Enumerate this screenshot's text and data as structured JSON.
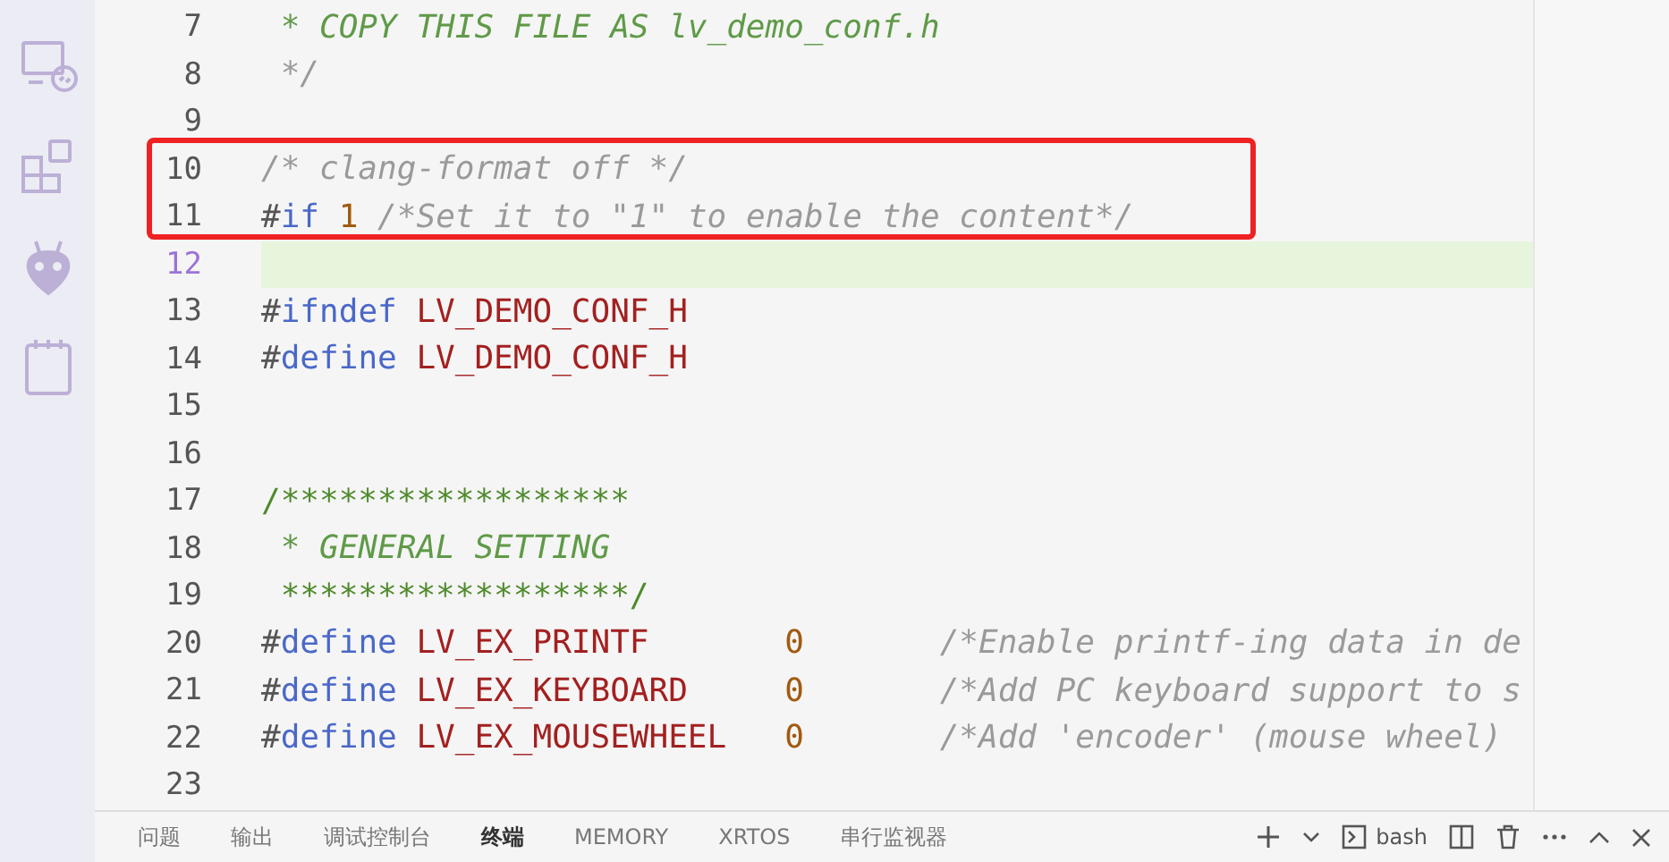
{
  "activity_bar": {
    "items": [
      {
        "kind": "remote",
        "selected": false
      },
      {
        "kind": "extensions",
        "selected": false
      },
      {
        "kind": "platformio",
        "selected": false
      },
      {
        "kind": "notes",
        "selected": false
      }
    ]
  },
  "editor": {
    "lines": [
      {
        "number": "7",
        "current": false,
        "highlighted": false,
        "tokens": [
          {
            "kind": "doc",
            "text": " * COPY THIS FILE AS lv_demo_conf.h"
          }
        ]
      },
      {
        "number": "8",
        "current": false,
        "highlighted": false,
        "tokens": [
          {
            "kind": "muted",
            "text": " */"
          }
        ]
      },
      {
        "number": "9",
        "current": false,
        "highlighted": false
      },
      {
        "number": "10",
        "current": false,
        "highlighted": false,
        "tokens": [
          {
            "kind": "muted",
            "text": "/* clang-format off */"
          }
        ]
      },
      {
        "number": "11",
        "current": false,
        "highlighted": false,
        "tokens": [
          {
            "kind": "plain",
            "text": "#"
          },
          {
            "kind": "keyword",
            "text": "if"
          },
          {
            "kind": "number",
            "text": " 1"
          },
          {
            "kind": "muted",
            "text": " /*Set it to \"1\" to enable the content*/"
          }
        ]
      },
      {
        "number": "12",
        "current": true,
        "highlighted": true
      },
      {
        "number": "13",
        "current": false,
        "highlighted": false,
        "tokens": [
          {
            "kind": "plain",
            "text": "#"
          },
          {
            "kind": "keyword",
            "text": "ifndef"
          },
          {
            "kind": "macro",
            "text": " LV_DEMO_CONF_H"
          }
        ]
      },
      {
        "number": "14",
        "current": false,
        "highlighted": false,
        "tokens": [
          {
            "kind": "plain",
            "text": "#"
          },
          {
            "kind": "keyword",
            "text": "define"
          },
          {
            "kind": "macro",
            "text": " LV_DEMO_CONF_H"
          }
        ]
      },
      {
        "number": "15",
        "current": false,
        "highlighted": false
      },
      {
        "number": "16",
        "current": false,
        "highlighted": false
      },
      {
        "number": "17",
        "current": false,
        "highlighted": false,
        "tokens": [
          {
            "kind": "banner",
            "text": "/******************"
          }
        ]
      },
      {
        "number": "18",
        "current": false,
        "highlighted": false,
        "tokens": [
          {
            "kind": "doc",
            "text": " * GENERAL SETTING"
          }
        ]
      },
      {
        "number": "19",
        "current": false,
        "highlighted": false,
        "tokens": [
          {
            "kind": "banner",
            "text": " ******************/"
          }
        ]
      },
      {
        "number": "20",
        "current": false,
        "highlighted": false,
        "tokens": [
          {
            "kind": "plain",
            "text": "#"
          },
          {
            "kind": "keyword",
            "text": "define"
          },
          {
            "kind": "macro",
            "text": " LV_EX_PRINTF"
          },
          {
            "kind": "number",
            "text": "       0"
          },
          {
            "kind": "muted",
            "text": "       /*Enable printf-ing data in de"
          }
        ]
      },
      {
        "number": "21",
        "current": false,
        "highlighted": false,
        "tokens": [
          {
            "kind": "plain",
            "text": "#"
          },
          {
            "kind": "keyword",
            "text": "define"
          },
          {
            "kind": "macro",
            "text": " LV_EX_KEYBOARD"
          },
          {
            "kind": "number",
            "text": "     0"
          },
          {
            "kind": "muted",
            "text": "       /*Add PC keyboard support to s"
          }
        ]
      },
      {
        "number": "22",
        "current": false,
        "highlighted": false,
        "tokens": [
          {
            "kind": "plain",
            "text": "#"
          },
          {
            "kind": "keyword",
            "text": "define"
          },
          {
            "kind": "macro",
            "text": " LV_EX_MOUSEWHEEL"
          },
          {
            "kind": "number",
            "text": "   0"
          },
          {
            "kind": "muted",
            "text": "       /*Add 'encoder' (mouse wheel)"
          }
        ]
      },
      {
        "number": "23",
        "current": false,
        "highlighted": false
      }
    ]
  },
  "annotation": {
    "kind": "rectangle",
    "color": "#ee2222"
  },
  "panel": {
    "tabs": [
      {
        "label": "问题",
        "selected": false
      },
      {
        "label": "输出",
        "selected": false
      },
      {
        "label": "调试控制台",
        "selected": false
      },
      {
        "label": "终端",
        "selected": true
      },
      {
        "label": "MEMORY",
        "selected": false
      },
      {
        "label": "XRTOS",
        "selected": false
      },
      {
        "label": "串行监视器",
        "selected": false
      }
    ],
    "terminal_name": "bash"
  }
}
